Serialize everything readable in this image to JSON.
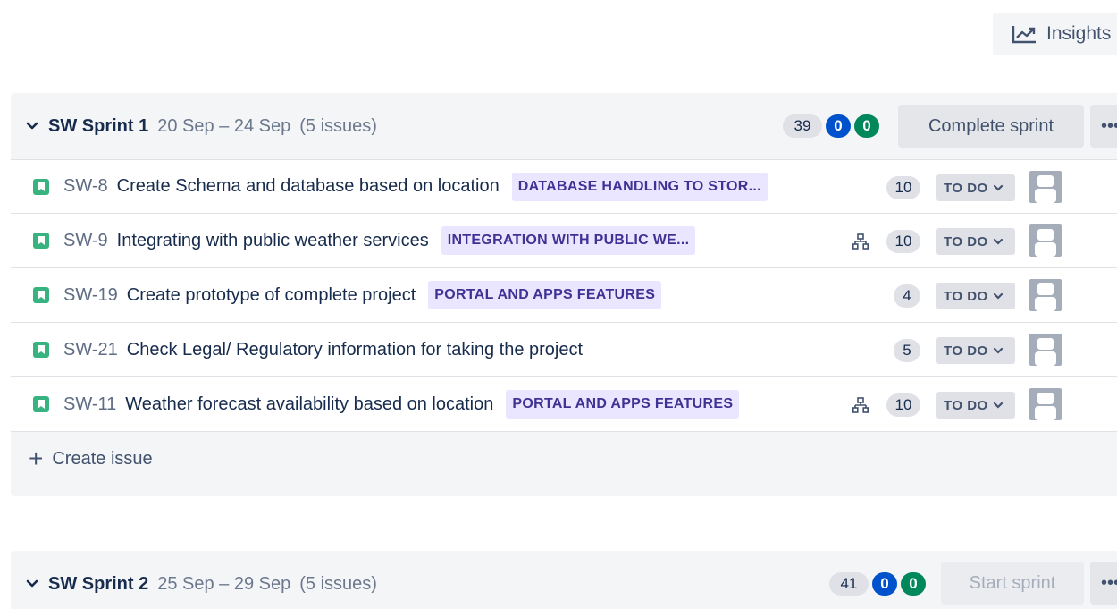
{
  "toolbar": {
    "insights_label": "Insights"
  },
  "sprints": [
    {
      "name": "SW Sprint 1",
      "dates": "20 Sep – 24 Sep",
      "issue_count": "(5 issues)",
      "counts": {
        "total": "39",
        "in_progress": "0",
        "done": "0"
      },
      "action_label": "Complete sprint",
      "more_label": "•••",
      "issues": [
        {
          "key": "SW-8",
          "summary": "Create Schema and database based on location",
          "epic": "DATABASE HANDLING TO STOR...",
          "has_children": false,
          "points": "10",
          "status": "TO DO"
        },
        {
          "key": "SW-9",
          "summary": "Integrating with public weather services",
          "epic": "INTEGRATION WITH PUBLIC WE...",
          "has_children": true,
          "points": "10",
          "status": "TO DO"
        },
        {
          "key": "SW-19",
          "summary": "Create prototype of complete project",
          "epic": "PORTAL AND APPS FEATURES",
          "has_children": false,
          "points": "4",
          "status": "TO DO"
        },
        {
          "key": "SW-21",
          "summary": "Check Legal/ Regulatory information for taking the project",
          "epic": "",
          "has_children": false,
          "points": "5",
          "status": "TO DO"
        },
        {
          "key": "SW-11",
          "summary": "Weather forecast availability based on location",
          "epic": "PORTAL AND APPS FEATURES",
          "has_children": true,
          "points": "10",
          "status": "TO DO"
        }
      ],
      "create_issue_label": "Create issue"
    },
    {
      "name": "SW Sprint 2",
      "dates": "25 Sep – 29 Sep",
      "issue_count": "(5 issues)",
      "counts": {
        "total": "41",
        "in_progress": "0",
        "done": "0"
      },
      "action_label": "Start sprint",
      "more_label": "•••"
    }
  ],
  "colors": {
    "story": "#36B37E",
    "epic_bg": "#EAE6FF",
    "epic_text": "#403294",
    "in_progress_badge": "#0052CC",
    "done_badge": "#00875A"
  },
  "icons": {
    "insights": "trend-chart-icon",
    "collapse": "chevron-down-icon",
    "story": "bookmark-story-icon",
    "child_issues": "hierarchy-icon",
    "status_dropdown": "chevron-down-icon",
    "avatar": "person-placeholder-icon",
    "create": "plus-icon"
  }
}
